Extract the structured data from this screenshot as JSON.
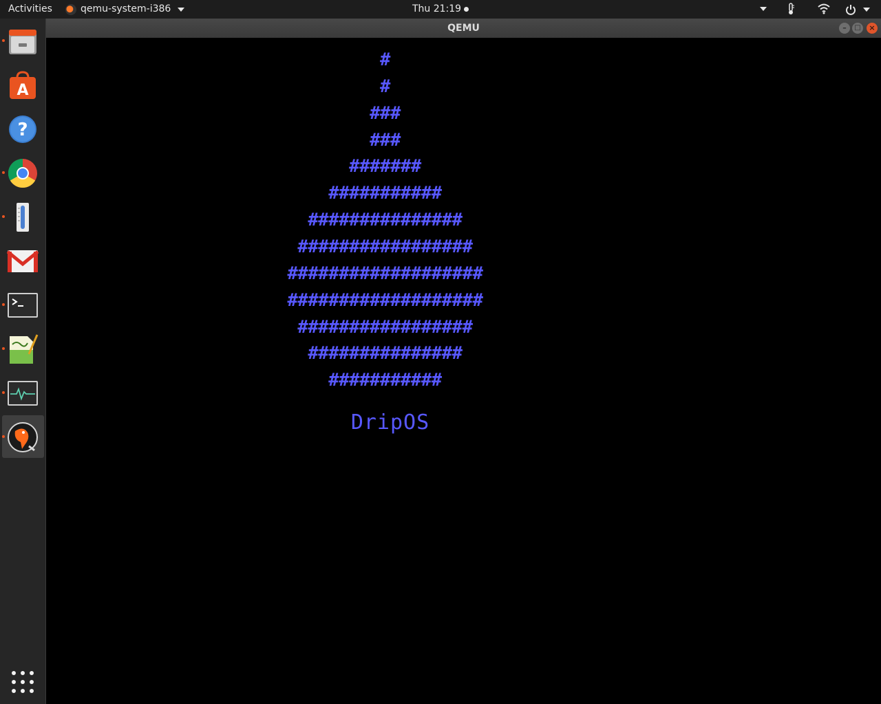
{
  "topbar": {
    "activities": "Activities",
    "app_name": "qemu-system-i386",
    "clock": "Thu 21:19"
  },
  "window": {
    "title": "QEMU"
  },
  "screen": {
    "logo_lines": [
      "#",
      "#",
      "###",
      "###",
      "#######",
      "###########",
      "###############",
      "#################",
      "###################",
      "###################",
      "#################",
      "###############",
      "###########"
    ],
    "os_name": "DripOS"
  },
  "dock": {
    "items": [
      {
        "name": "files-icon"
      },
      {
        "name": "software-center-icon"
      },
      {
        "name": "help-icon"
      },
      {
        "name": "chrome-icon"
      },
      {
        "name": "thermometer-icon"
      },
      {
        "name": "gmail-icon"
      },
      {
        "name": "terminal-icon"
      },
      {
        "name": "text-editor-icon"
      },
      {
        "name": "system-monitor-icon"
      },
      {
        "name": "qemu-icon"
      }
    ]
  },
  "colors": {
    "screen_text": "#5858ff",
    "accent": "#e95420"
  }
}
